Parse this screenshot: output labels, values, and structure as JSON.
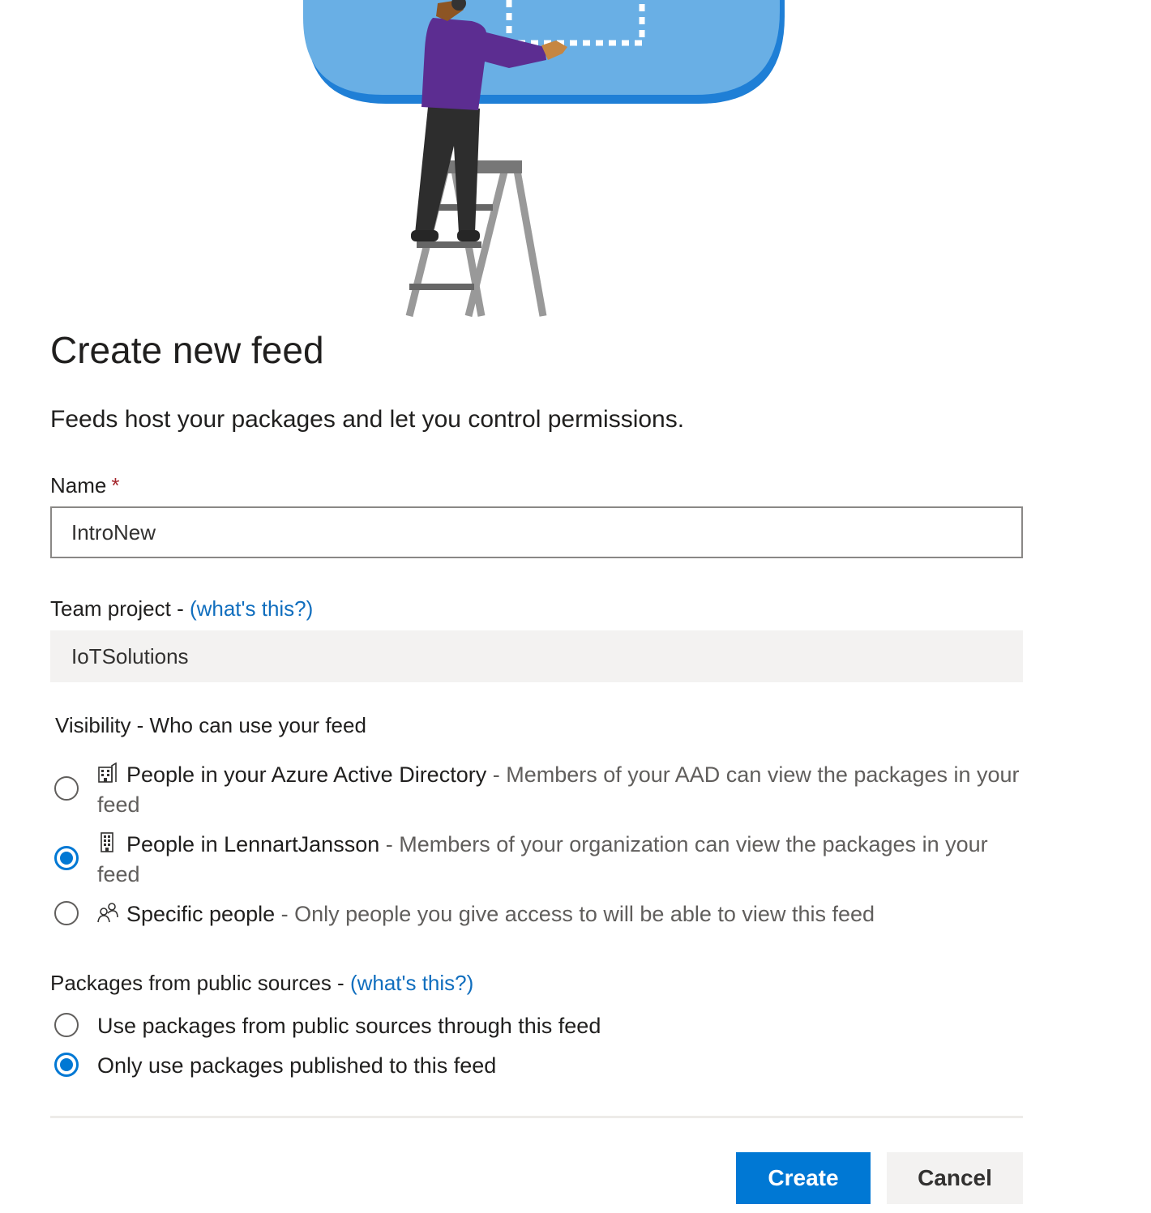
{
  "dialog": {
    "title": "Create new feed",
    "subtitle": "Feeds host your packages and let you control permissions."
  },
  "name_field": {
    "label": "Name",
    "required_marker": "*",
    "value": "IntroNew"
  },
  "team_project": {
    "label": "Team project - ",
    "help_link": "(what's this?)",
    "value": "IoTSolutions"
  },
  "visibility": {
    "label": "Visibility - Who can use your feed",
    "options": [
      {
        "icon": "building-icon",
        "title": "People in your Azure Active Directory",
        "description": " - Members of your AAD can view the packages in your feed",
        "selected": false
      },
      {
        "icon": "organization-icon",
        "title": "People in LennartJansson",
        "description": " - Members of your organization can view the packages in your feed",
        "selected": true
      },
      {
        "icon": "people-icon",
        "title": "Specific people",
        "description": " - Only people you give access to will be able to view this feed",
        "selected": false
      }
    ]
  },
  "public_sources": {
    "label": "Packages from public sources - ",
    "help_link": "(what's this?)",
    "options": [
      {
        "label": "Use packages from public sources through this feed",
        "selected": false
      },
      {
        "label": "Only use packages published to this feed",
        "selected": true
      }
    ]
  },
  "buttons": {
    "create": "Create",
    "cancel": "Cancel"
  },
  "colors": {
    "accent": "#0078d4",
    "link": "#106ebe",
    "required": "#a4262c",
    "cloud": "#69afe5",
    "shirt": "#5c2d91"
  }
}
